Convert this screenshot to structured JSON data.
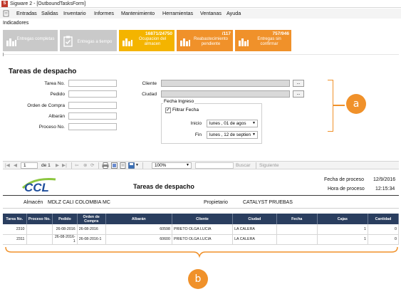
{
  "window": {
    "title": "Sigware 2 - [OutboundTasksForm]",
    "app_icon": "S"
  },
  "menu": [
    "Entradas",
    "Salidas",
    "Inventario",
    "Informes",
    "Mantenimiento",
    "Herramientas",
    "Ventanas",
    "Ayuda"
  ],
  "indicators_label": "Indicadores",
  "tiles": [
    {
      "value": "",
      "label": "Entregas completas",
      "color": "#c9c9c9",
      "icon": "bar-chart-icon"
    },
    {
      "value": "",
      "label": "Entregas a tiempo",
      "color": "#c9c9c9",
      "icon": "clipboard-check-icon"
    },
    {
      "value": "16871/24750",
      "label": "Ocupacion del almacen",
      "color": "#f4b400",
      "icon": "bar-chart-icon"
    },
    {
      "value": "/117",
      "label": "Reabastecimiento pendiente",
      "color": "#f0912a",
      "icon": "bar-chart-icon"
    },
    {
      "value": "757/946",
      "label": "Entregas sin confirmar",
      "color": "#f0912a",
      "icon": "bar-chart-icon"
    }
  ],
  "form": {
    "title": "Tareas de despacho",
    "fields_left": [
      {
        "label": "Tarea No.",
        "value": ""
      },
      {
        "label": "Pedido",
        "value": ""
      },
      {
        "label": "Orden de Compra",
        "value": ""
      },
      {
        "label": "Albarán",
        "value": ""
      },
      {
        "label": "Proceso No.",
        "value": ""
      }
    ],
    "cliente_label": "Cliente",
    "ciudad_label": "Ciudad",
    "browse_label": "...",
    "fecha_group": "Fecha Ingreso",
    "filtrar_label": "Filtrar Fecha",
    "filtrar_checked": "✓",
    "inicio_label": "Inicio",
    "inicio_value": "lunes   , 01 de   agos",
    "fin_label": "Fin",
    "fin_value": "lunes   , 12 de septien"
  },
  "callouts": {
    "a": "a",
    "b": "b"
  },
  "report_toolbar": {
    "page_value": "1",
    "page_of": "de 1",
    "zoom": "100%",
    "search_label": "Buscar",
    "next_label": "Siguiente"
  },
  "report": {
    "logo_text": "CCL",
    "title": "Tareas de despacho",
    "fecha_label": "Fecha de proceso",
    "fecha_value": "12/9/2016",
    "hora_label": "Hora de proceso",
    "hora_value": "12:15:34",
    "almacen_label": "Almacén",
    "almacen_value": "MDLZ CALI COLOMBIA MC",
    "propietario_label": "Propietario",
    "propietario_value": "CATALYST PRUEBAS",
    "columns": [
      "Tarea No.",
      "Proceso No.",
      "Pedido",
      "Orden de Compra",
      "Albarán",
      "Cliente",
      "Ciudad",
      "Fecha",
      "Cajas",
      "Cantidad"
    ],
    "rows": [
      [
        "2310",
        "",
        "26-08-2016",
        "26-08-2016",
        "60598",
        "PRIETO OLGA LUCIA",
        "LA CALERA",
        "",
        "1",
        "0"
      ],
      [
        "2311",
        "",
        "26-08-2016-1",
        "26-08-2016-1",
        "60600",
        "PRIETO OLGA LUCIA",
        "LA CALERA",
        "",
        "1",
        "0"
      ]
    ]
  }
}
